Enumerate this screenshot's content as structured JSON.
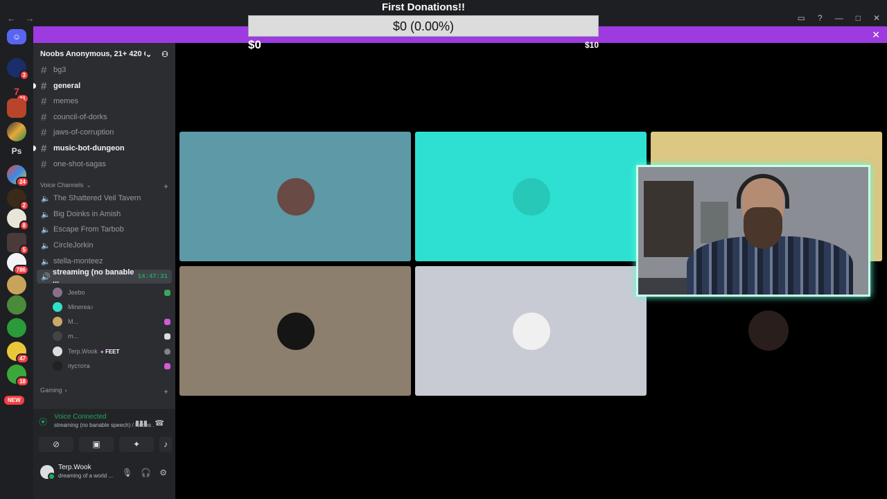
{
  "window": {
    "nav_back": "←",
    "nav_forward": "→"
  },
  "donation": {
    "title": "First Donations!!",
    "value_text": "$0 (0.00%)",
    "min_label": "$0",
    "max_label": "$10",
    "progress": 0.0
  },
  "banner": {
    "color": "#9d3be0"
  },
  "server": {
    "name": "Noobs Anonymous, 21+ 420 C...",
    "channels": [
      {
        "name": "bg3",
        "bold": false
      },
      {
        "name": "general",
        "bold": true
      },
      {
        "name": "memes",
        "bold": false
      },
      {
        "name": "council-of-dorks",
        "bold": false
      },
      {
        "name": "jaws-of-corruption",
        "bold": false
      },
      {
        "name": "music-bot-dungeon",
        "bold": true
      },
      {
        "name": "one-shot-sagas",
        "bold": false
      }
    ],
    "voice_category": "Voice Channels",
    "voice_channels": [
      "The Shattered Veil Tavern",
      "Big Doinks in Amish",
      "Escape From Tarbob",
      "CircleJorkin",
      "stella-monteez"
    ],
    "active_voice": {
      "name": "streaming (no banable ...",
      "time": "14:47:31"
    },
    "voice_users": [
      {
        "name": "Jeebo",
        "avatar_color": "#8a6f8a",
        "icon_color": "#3ba55c"
      },
      {
        "name": "Minerea♪",
        "avatar_color": "#2ee0c8",
        "icon_color": ""
      },
      {
        "name": "M...",
        "avatar_color": "#c9a86a",
        "icon_color": "#d35ad8"
      },
      {
        "name": "m...",
        "avatar_color": "#444",
        "icon_color": "#dbdee1"
      },
      {
        "name": "Terp.Wook",
        "avatar_color": "#dbdee1",
        "icon_color": "#80848e",
        "tag": "FEET"
      },
      {
        "name": "пустота",
        "avatar_color": "#222",
        "icon_color": "#d35ad8"
      }
    ],
    "gaming_category": "Gaming"
  },
  "server_badges": [
    "3",
    "31",
    "24",
    "2",
    "8",
    "5",
    "786",
    "47",
    "18"
  ],
  "new_badge": "NEW",
  "voice_panel": {
    "status": "Voice Connected",
    "detail": "streaming (no banable speech) / Noobs ..."
  },
  "user": {
    "name": "Terp.Wook",
    "status": "dreaming of a world ..."
  },
  "tiles": [
    {
      "bg": "#5d99a6",
      "avatar": "#6a4a44"
    },
    {
      "bg": "#2ee0d2",
      "avatar": "#28c8b8"
    },
    {
      "bg": "#dcc783",
      "avatar": ""
    },
    {
      "bg": "#8d7f6d",
      "avatar": "#151515"
    },
    {
      "bg": "#c8cbd4",
      "avatar": "#f0f0f0"
    },
    {
      "bg": "#000000",
      "avatar": "#2a1e1c"
    }
  ]
}
